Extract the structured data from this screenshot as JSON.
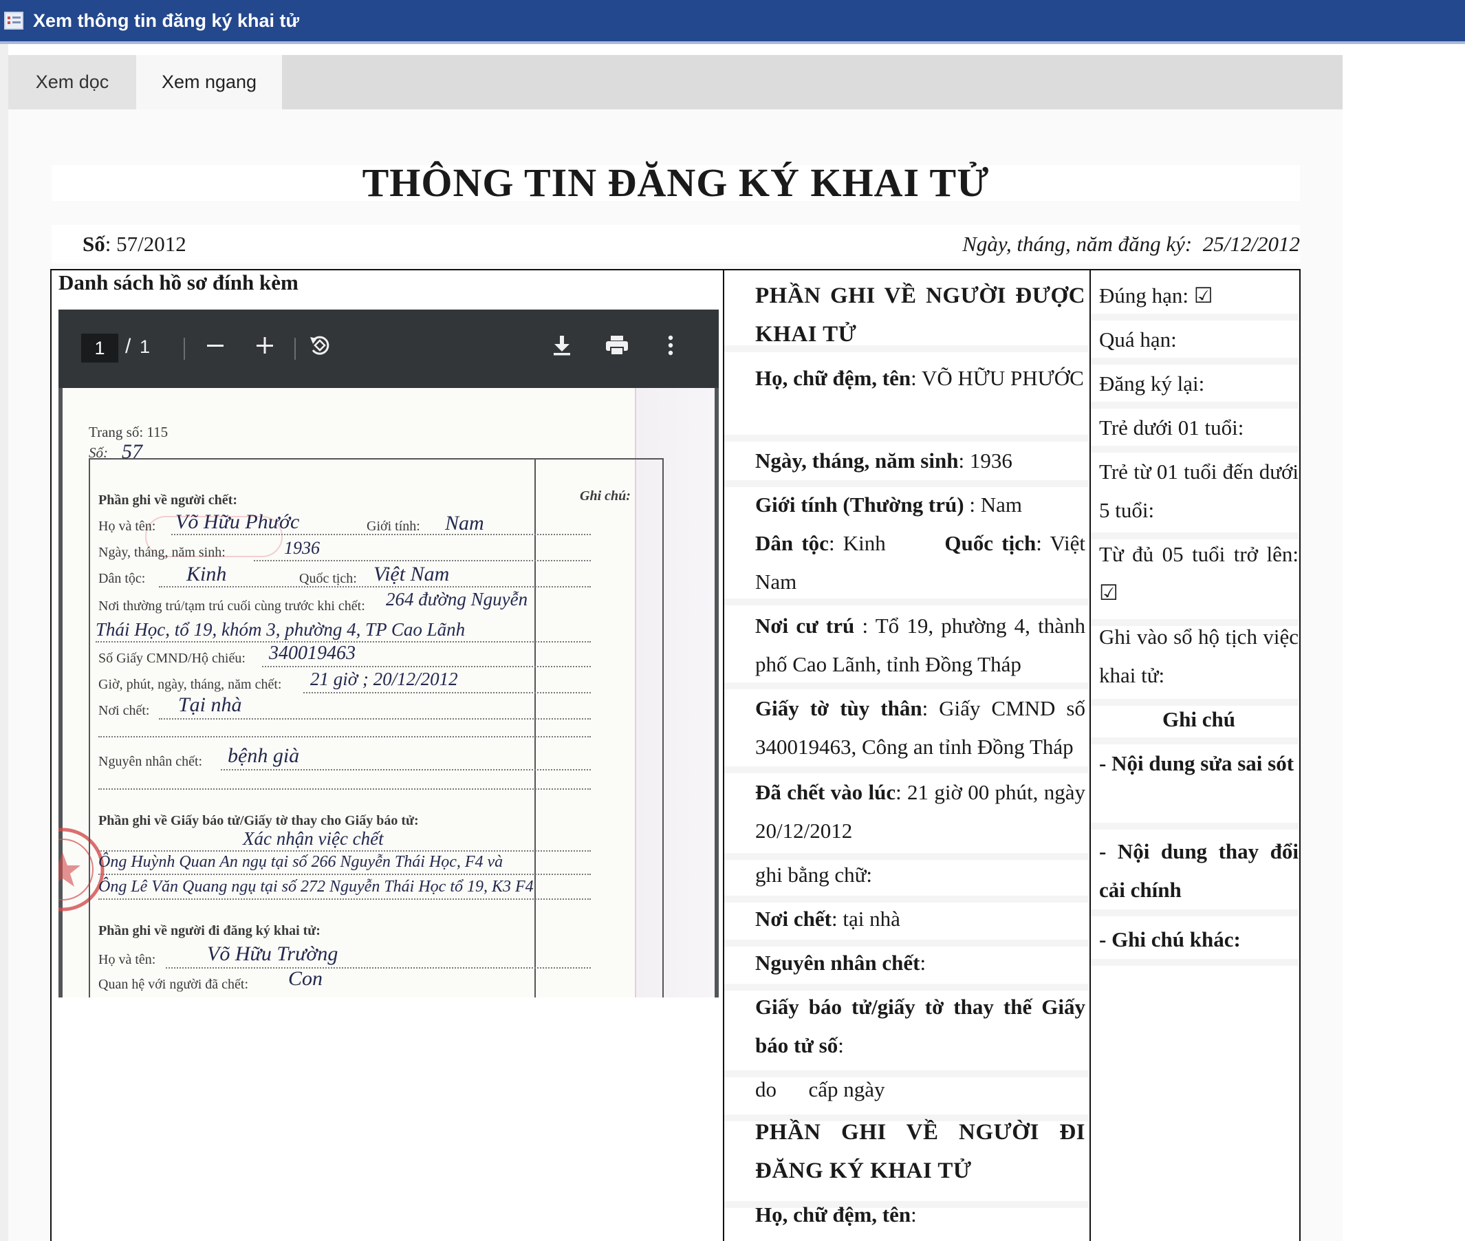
{
  "window": {
    "title": "Xem thông tin đăng ký khai tử"
  },
  "tabs": [
    {
      "label": "Xem dọc",
      "active": false
    },
    {
      "label": "Xem ngang",
      "active": true
    }
  ],
  "document": {
    "title": "THÔNG TIN ĐĂNG KÝ KHAI TỬ",
    "so_label": "Số",
    "so_value": ": 57/2012",
    "date_label": "Ngày, tháng, năm đăng ký:",
    "date_value": "25/12/2012"
  },
  "attachments": {
    "heading": "Danh sách hồ sơ đính kèm",
    "viewer": {
      "current_page": "1",
      "separator": "/",
      "total_pages": "1"
    },
    "scan": {
      "trang_so": "Trang số: 115",
      "so": "Số:",
      "so_hand": "57",
      "ghi_chu": "Ghi chú:",
      "phan_ghi_nguoi_chet": "Phần ghi về người chết:",
      "ho_va_ten": "Họ và tên:",
      "ho_va_ten_hand": "Võ Hữu Phước",
      "gioi_tinh": "Giới tính:",
      "gioi_tinh_hand": "Nam",
      "ngay_sinh": "Ngày, tháng, năm sinh:",
      "ngay_sinh_hand": "1936",
      "dan_toc": "Dân tộc:",
      "dan_toc_hand": "Kinh",
      "quoc_tich": "Quốc tịch:",
      "quoc_tich_hand": "Việt Nam",
      "noi_thuong_tru": "Nơi thường trú/tạm trú cuối cùng trước khi chết:",
      "noi_thuong_tru_hand1": "264 đường Nguyễn",
      "noi_thuong_tru_hand2": "Thái Học, tổ 19, khóm 3, phường 4, TP Cao Lãnh",
      "cmnd": "Số Giấy CMND/Hộ chiếu:",
      "cmnd_hand": "340019463",
      "gio_chet": "Giờ, phút, ngày, tháng, năm chết:",
      "gio_chet_hand": "21 giờ ; 20/12/2012",
      "noi_chet": "Nơi chết:",
      "noi_chet_hand": "Tại nhà",
      "nguyen_nhan": "Nguyên nhân chết:",
      "nguyen_nhan_hand": "bệnh già",
      "phan_giay_bao_tu": "Phần ghi về Giấy báo tử/Giấy tờ thay cho Giấy báo tử:",
      "giay_hand1": "Xác nhận việc chết",
      "giay_hand2": "Ông Huỳnh Quan An ngụ tại số 266 Nguyễn Thái Học, F4 và",
      "giay_hand3": "Ông Lê Văn Quang ngụ tại số 272 Nguyễn Thái Học tổ 19, K3 F4",
      "phan_nguoi_di_dk": "Phần ghi về người đi đăng ký khai tử:",
      "nguoi_dk_ten": "Họ và tên:",
      "nguoi_dk_ten_hand": "Võ Hữu Trường",
      "quan_he": "Quan hệ với người đã chết:",
      "quan_he_hand": "Con"
    }
  },
  "deceased": {
    "section_title": "PHẦN GHI VỀ NGƯỜI ĐƯỢC KHAI TỬ",
    "name_label": "Họ, chữ đệm, tên",
    "name_value": ": VÕ HỮU PHƯỚC",
    "dob_label": "Ngày, tháng, năm sinh",
    "dob_value": ": 1936",
    "gender_label": "Giới tính (Thường trú)",
    "gender_value": ": Nam",
    "ethnic_label": "Dân tộc",
    "ethnic_value": ": Kinh",
    "nationality_label": "Quốc tịch",
    "nationality_value": ": Việt Nam",
    "residence_label": "Nơi cư trú",
    "residence_value": " : Tổ 19, phường 4, thành phố Cao Lãnh, tỉnh Đồng Tháp",
    "id_label": "Giấy tờ tùy thân",
    "id_value": ": Giấy CMND số 340019463, Công an tỉnh Đồng Tháp",
    "death_time_label": "Đã chết vào lúc",
    "death_time_value": ": 21 giờ 00 phút, ngày 20/12/2012",
    "in_words": "ghi bằng chữ:",
    "place_label": "Nơi chết",
    "place_value": ": tại nhà",
    "cause_label": "Nguyên nhân chết",
    "cause_value": ":",
    "cert_label": "Giấy báo tử/giấy tờ thay thế Giấy báo tử số",
    "cert_value": ":",
    "issued": "do      cấp ngày",
    "registrant_title": "PHẦN GHI VỀ NGƯỜI ĐI ĐĂNG KÝ KHAI TỬ",
    "registrant_name_label": "Họ, chữ đệm, tên",
    "registrant_name_value": ":"
  },
  "status": {
    "on_time": "Đúng hạn: ☑",
    "overdue": "Quá hạn:",
    "reregister": "Đăng ký lại:",
    "under_1": "Trẻ dưới 01 tuổi:",
    "from_1_to_5": "Trẻ từ 01 tuổi đến dưới 5 tuổi:",
    "from_5_up": "Từ đủ 05 tuổi trở lên: ☑",
    "book_record": "Ghi vào sổ hộ tịch việc khai tử:",
    "notes_title": "Ghi chú",
    "note_1": "- Nội dung sửa sai sót",
    "note_2": "- Nội dung thay đổi cải chính",
    "note_3": "- Ghi chú khác:"
  }
}
